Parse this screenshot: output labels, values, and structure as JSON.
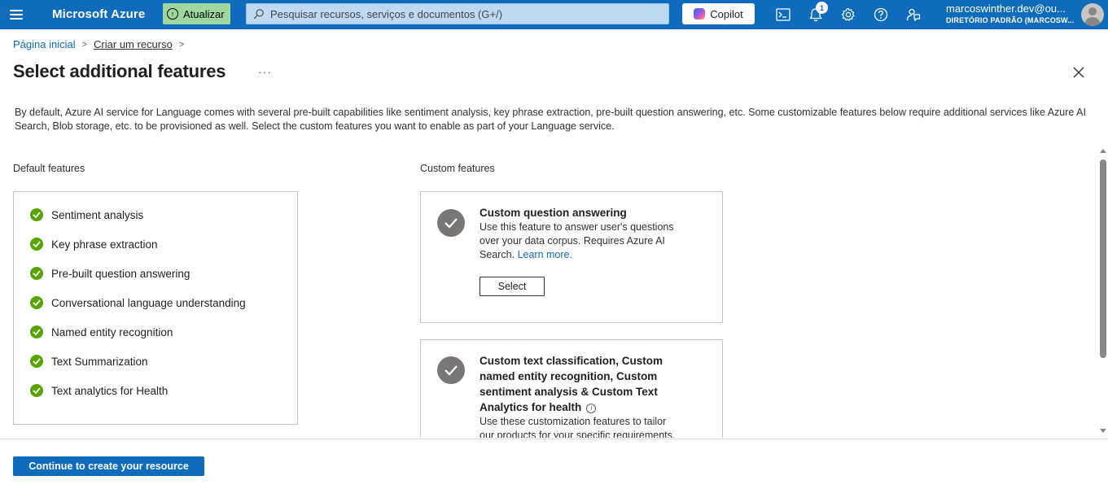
{
  "topbar": {
    "brand": "Microsoft Azure",
    "upgrade_label": "Atualizar",
    "search_placeholder": "Pesquisar recursos, serviços e documentos (G+/)",
    "copilot_label": "Copilot",
    "notification_count": "1",
    "account_email": "marcoswinther.dev@ou...",
    "account_directory": "DIRETÓRIO PADRÃO (MARCOSW...",
    "colors": {
      "bar": "#0f6cbd",
      "upgrade": "#9fd89f"
    },
    "icons": [
      "menu-icon",
      "upgrade-icon",
      "search-icon",
      "copilot-icon",
      "cloud-shell-icon",
      "bell-icon",
      "gear-icon",
      "help-icon",
      "feedback-icon",
      "avatar-icon"
    ]
  },
  "breadcrumb": {
    "home": "Página inicial",
    "create": "Criar um recurso"
  },
  "page": {
    "title": "Select additional features",
    "more": "···",
    "description": "By default, Azure AI service for Language comes with several pre-built capabilities like sentiment analysis, key phrase extraction, pre-built question answering, etc. Some customizable features below require additional services like Azure AI Search, Blob storage, etc. to be provisioned as well. Select the custom features you want to enable as part of your Language service."
  },
  "default_features": {
    "label": "Default features",
    "items": [
      "Sentiment analysis",
      "Key phrase extraction",
      "Pre-built question answering",
      "Conversational language understanding",
      "Named entity recognition",
      "Text Summarization",
      "Text analytics for Health"
    ],
    "check_color": "#57a300"
  },
  "custom_features": {
    "label": "Custom features",
    "cards": [
      {
        "title": "Custom question answering",
        "text": "Use this feature to answer user's questions over your data corpus. Requires Azure AI Search.",
        "link": "Learn more.",
        "button": "Select"
      },
      {
        "title": "Custom text classification, Custom named entity recognition, Custom sentiment analysis & Custom Text Analytics for health",
        "text": "Use these customization features to tailor our products for your specific requirements."
      }
    ]
  },
  "footer": {
    "continue_label": "Continue to create your resource"
  }
}
